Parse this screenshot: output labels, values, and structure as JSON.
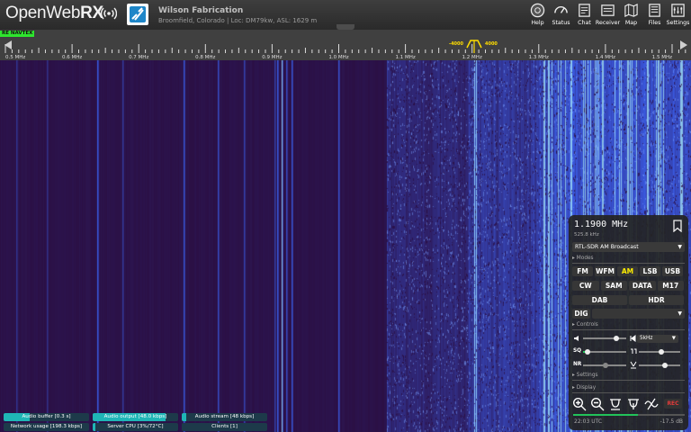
{
  "header": {
    "logo_main": "OpenWeb",
    "logo_bold": "RX",
    "receiver_name": "Wilson Fabrication",
    "receiver_desc": "Broomfield, Colorado | Loc: DM79kw, ASL: 1629 m",
    "nav": [
      {
        "label": "Help",
        "icon": "help-icon"
      },
      {
        "label": "Status",
        "icon": "status-icon"
      },
      {
        "label": "Chat",
        "icon": "chat-icon"
      },
      {
        "label": "Receiver",
        "icon": "receiver-icon"
      },
      {
        "label": "Map",
        "icon": "map-icon"
      },
      {
        "label": "Files",
        "icon": "files-icon"
      },
      {
        "label": "Settings",
        "icon": "settings-icon"
      }
    ]
  },
  "scale": {
    "bookmark_label": "RE NAVTEX",
    "filter_low": "-4000",
    "filter_high": "4000",
    "ticks": [
      "0.5 MHz",
      "0.6 MHz",
      "0.7 MHz",
      "0.8 MHz",
      "0.9 MHz",
      "1.0 MHz",
      "1.1 MHz",
      "1.2 MHz",
      "1.3 MHz",
      "1.4 MHz",
      "1.5 MHz"
    ]
  },
  "panel": {
    "frequency": "1.1900 MHz",
    "wavelength": "525.8 kHz",
    "profile": "RTL-SDR AM Broadcast",
    "sections": {
      "modes": "Modes",
      "controls": "Controls",
      "settings": "Settings",
      "display": "Display"
    },
    "modes_row1": [
      "FM",
      "WFM",
      "AM",
      "LSB",
      "USB"
    ],
    "modes_row2": [
      "CW",
      "SAM",
      "DATA",
      "M17"
    ],
    "modes_row3": [
      "DAB",
      "HDR"
    ],
    "digital_label": "DIG",
    "active_mode": "AM",
    "step": "5kHz",
    "controls": {
      "squelch_label": "SQ",
      "nr_label": "NR"
    },
    "volume_level": 0.78,
    "squelch_level": 0.1,
    "record_label": "REC",
    "clock": "22:03 UTC",
    "level": "-17.5 dB",
    "smeter_level": 0.58
  },
  "status_bars": [
    {
      "label": "Audio buffer [0.3 s]",
      "fill": 0.3
    },
    {
      "label": "Audio output [48.0 kbps]",
      "fill": 0.85
    },
    {
      "label": "Audio stream [48 kbps]",
      "fill": 0.05
    },
    {
      "label": "Network usage [198.3 kbps]",
      "fill": 0.0
    },
    {
      "label": "Server CPU [3%/72°C]",
      "fill": 0.03
    },
    {
      "label": "Clients [1]",
      "fill": 0.0
    }
  ],
  "colors": {
    "waterfall_bg": "#2a0c3d",
    "signal": "#3a4fd8",
    "active_mode": "#ffee00",
    "bookmark": "#2ee62e",
    "filter": "#ffdd00"
  }
}
